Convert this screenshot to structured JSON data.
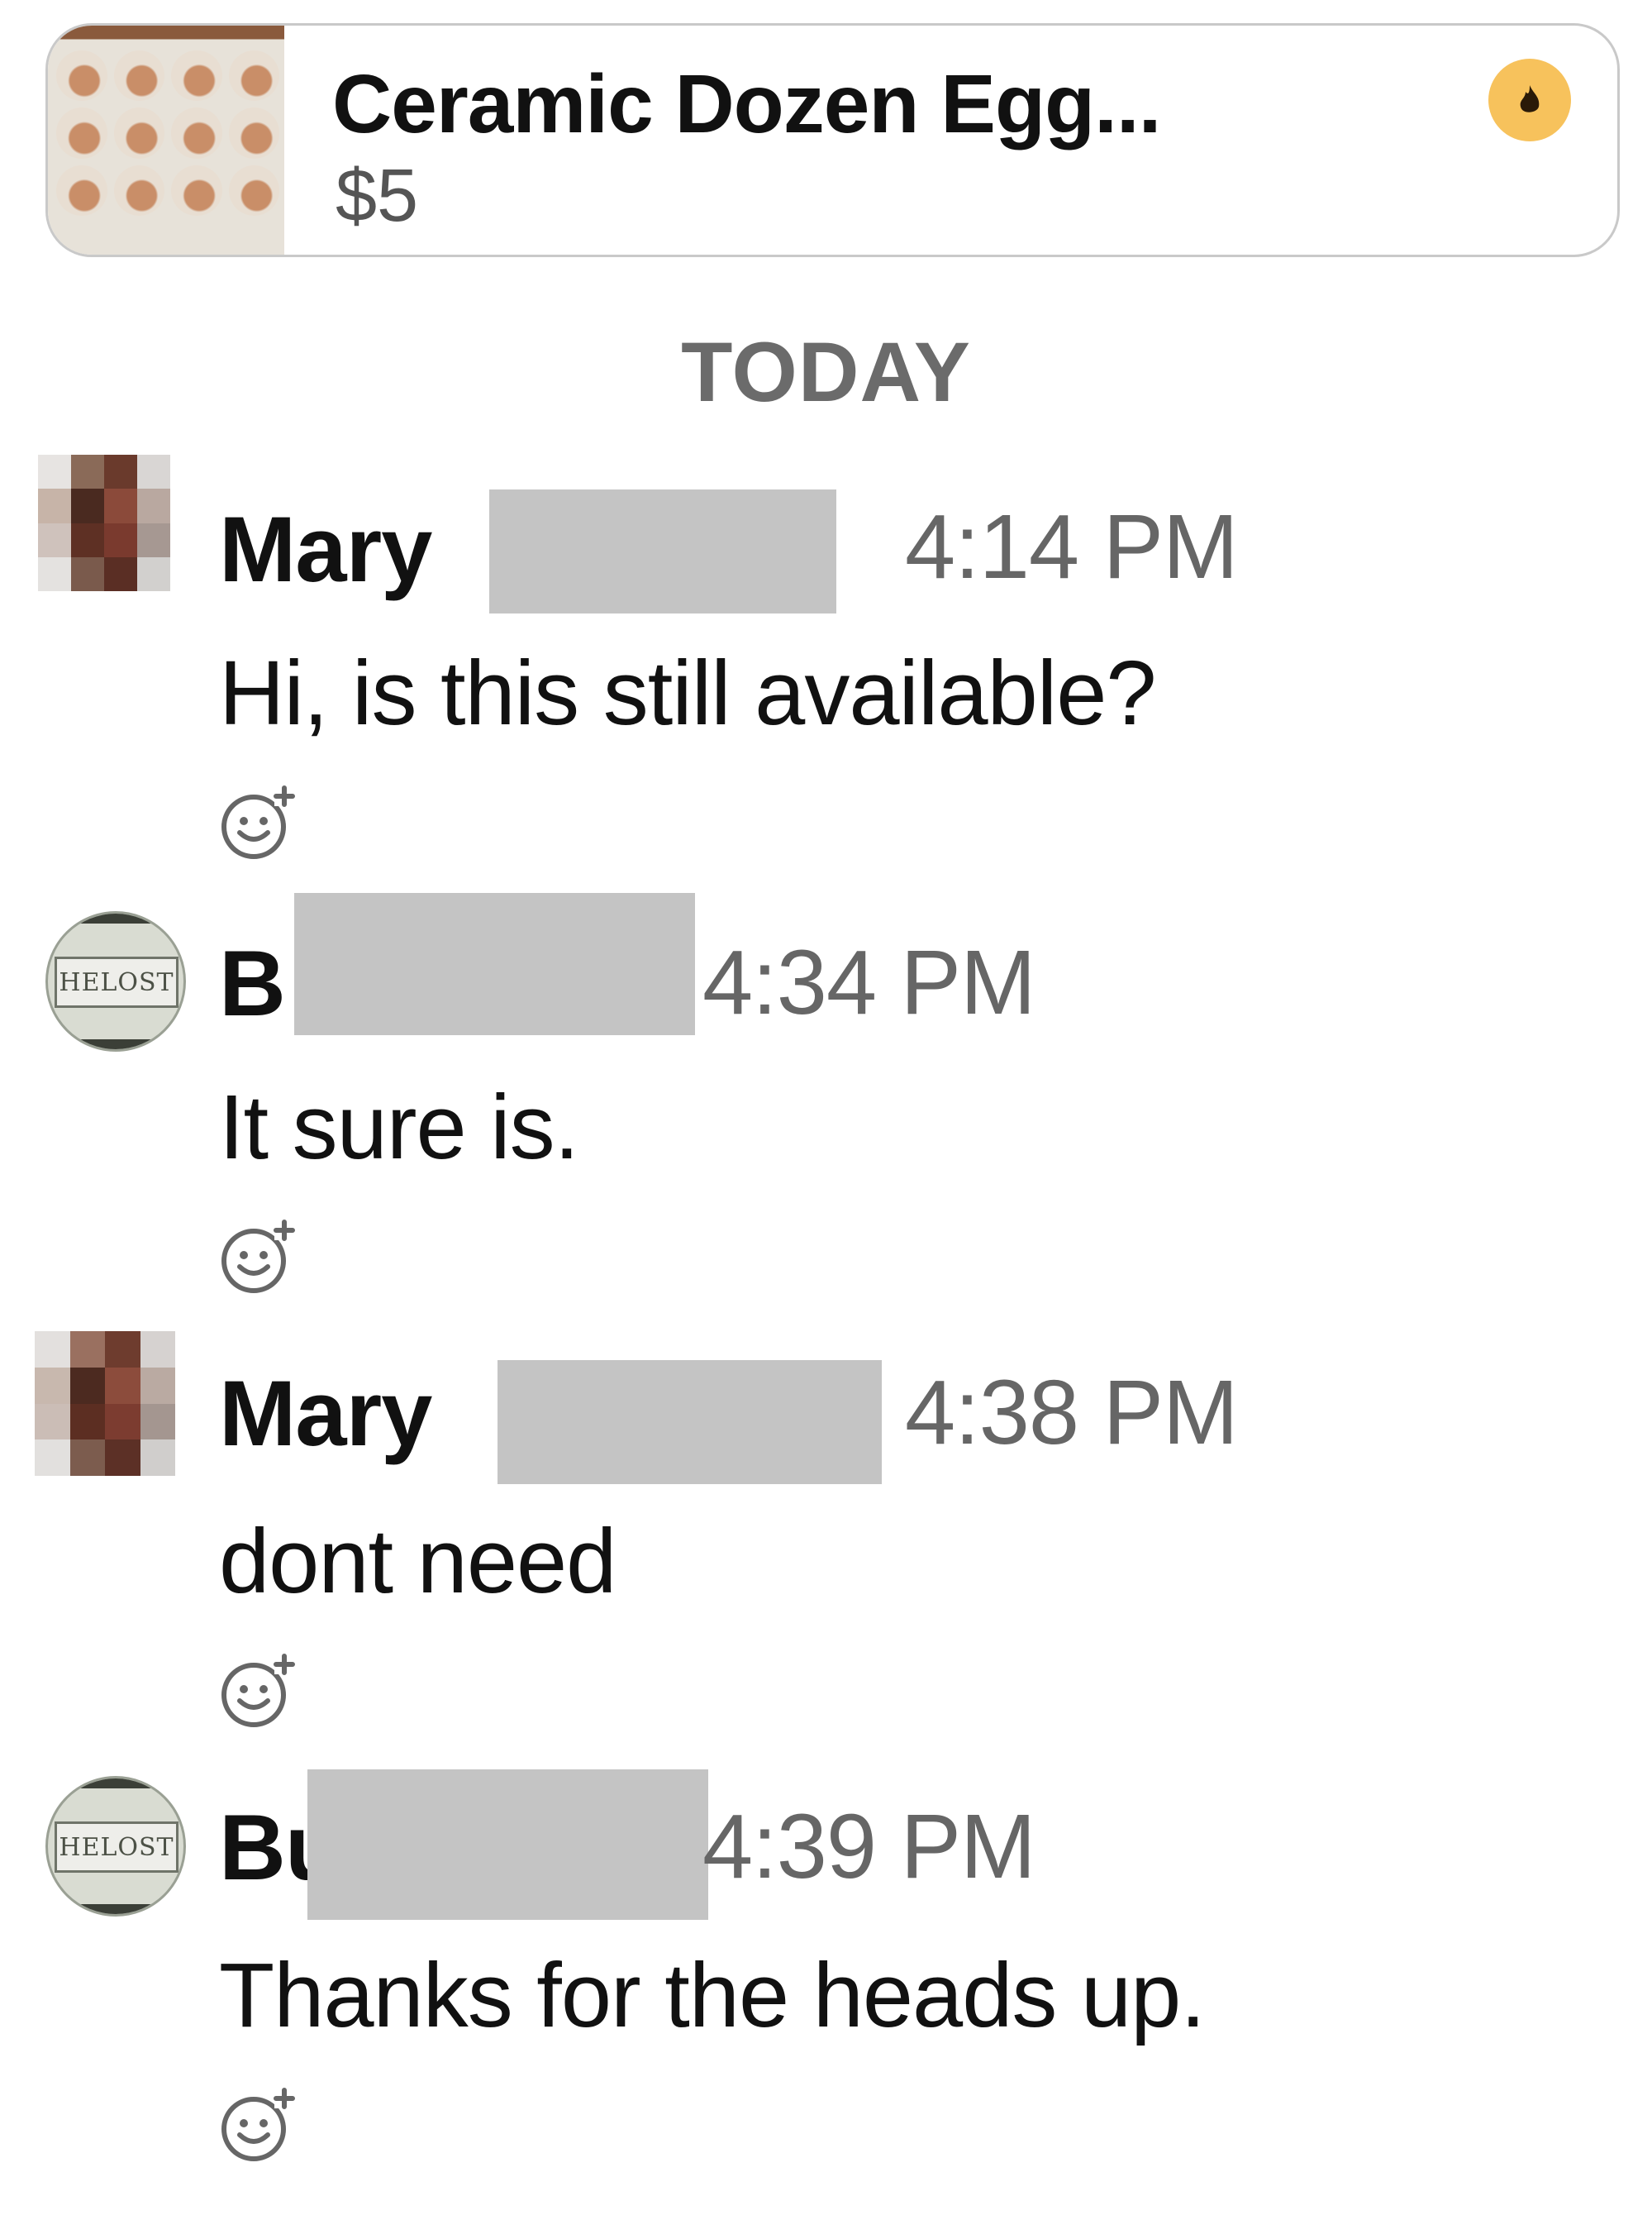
{
  "listing": {
    "title": "Ceramic Dozen Egg...",
    "price": "$5",
    "badge_icon": "flame-icon"
  },
  "divider": {
    "label": "TODAY"
  },
  "messages": [
    {
      "sender": "Mary",
      "time": "4:14 PM",
      "text": "Hi, is this still available?"
    },
    {
      "sender": "B",
      "time": "4:34 PM",
      "text": "It sure is."
    },
    {
      "sender": "Mary",
      "time": "4:38 PM",
      "text": "dont need"
    },
    {
      "sender": "Bu",
      "time": "4:39 PM",
      "text": "Thanks for the heads up."
    }
  ],
  "avatars": {
    "plate_text": "HELOST"
  },
  "colors": {
    "redaction": "#c4c4c4",
    "badge": "#f7c25c",
    "timestamp": "#666666"
  },
  "icons": {
    "reaction": "add-reaction-icon",
    "listing_thumb": "egg-tray-image"
  }
}
